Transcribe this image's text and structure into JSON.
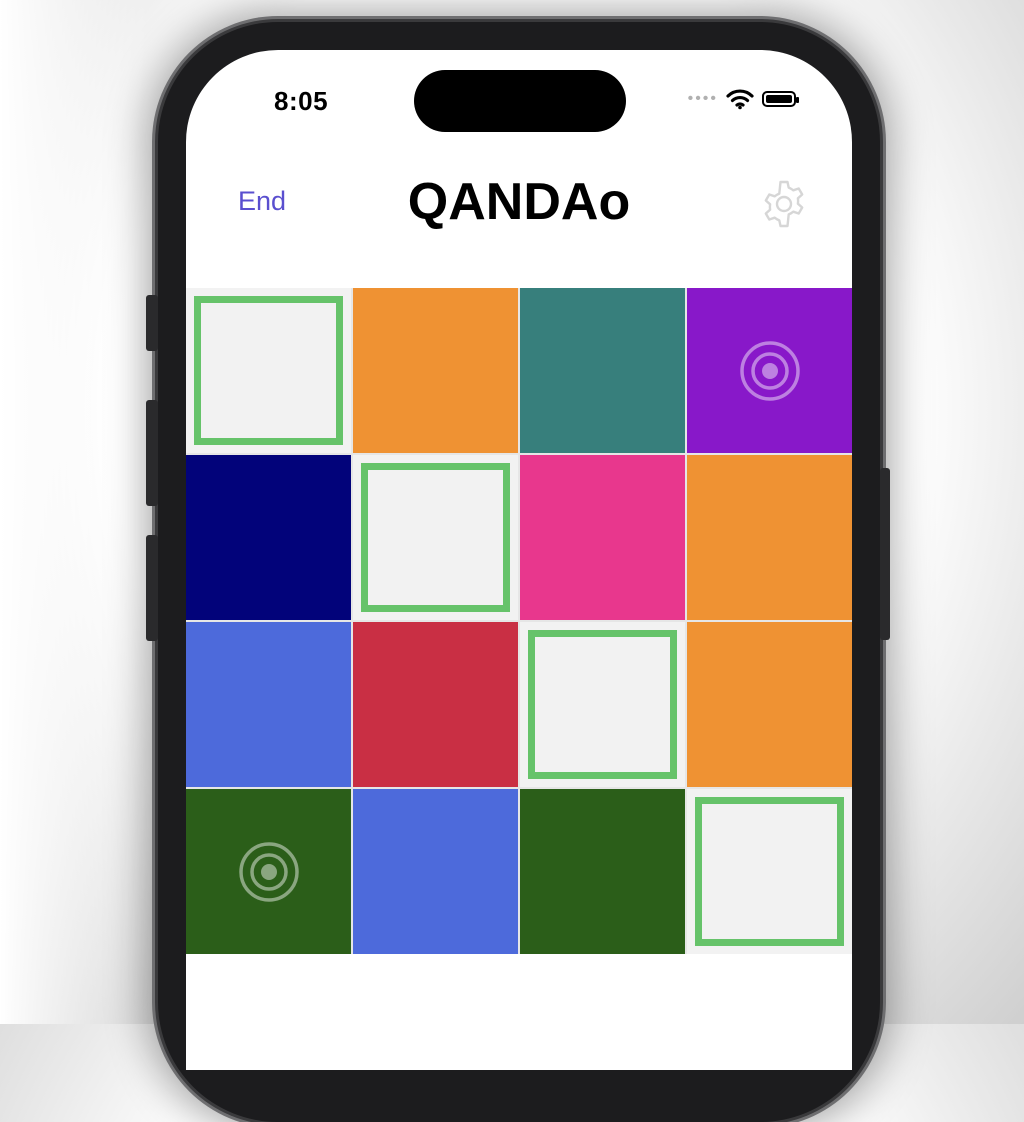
{
  "status_bar": {
    "time": "8:05",
    "signal_icon": "cellular-dots",
    "wifi_icon": "wifi-icon",
    "battery_icon": "battery-icon"
  },
  "nav": {
    "end_label": "End",
    "title": "QANDAo",
    "settings_icon": "gear-icon"
  },
  "colors": {
    "accent": "#5a4fcf",
    "target_border": "#66c36a",
    "empty": "#f2f2f2"
  },
  "grid": {
    "rows": 4,
    "cols": 4,
    "cells": [
      {
        "color": "#f2f2f2",
        "target": true,
        "ring": false
      },
      {
        "color": "#ef9233",
        "target": false,
        "ring": false
      },
      {
        "color": "#377f7c",
        "target": false,
        "ring": false
      },
      {
        "color": "#8818c9",
        "target": false,
        "ring": true
      },
      {
        "color": "#02037a",
        "target": false,
        "ring": false
      },
      {
        "color": "#f2f2f2",
        "target": true,
        "ring": false
      },
      {
        "color": "#e8378d",
        "target": false,
        "ring": false
      },
      {
        "color": "#ef9233",
        "target": false,
        "ring": false
      },
      {
        "color": "#4d6adb",
        "target": false,
        "ring": false
      },
      {
        "color": "#c92f44",
        "target": false,
        "ring": false
      },
      {
        "color": "#f2f2f2",
        "target": true,
        "ring": false
      },
      {
        "color": "#ef9233",
        "target": false,
        "ring": false
      },
      {
        "color": "#2b5e19",
        "target": false,
        "ring": true
      },
      {
        "color": "#4d6adb",
        "target": false,
        "ring": false
      },
      {
        "color": "#2b5e19",
        "target": false,
        "ring": false
      },
      {
        "color": "#f2f2f2",
        "target": true,
        "ring": false
      }
    ]
  }
}
